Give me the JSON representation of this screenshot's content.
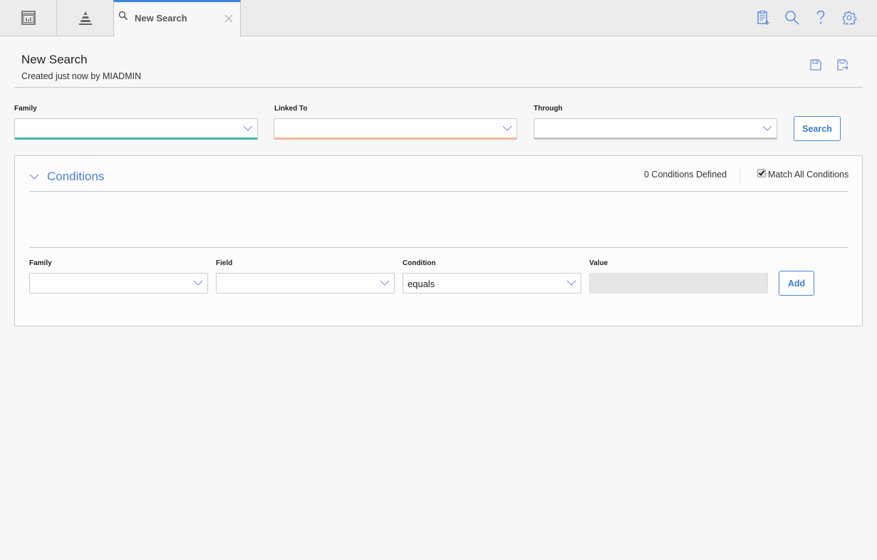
{
  "topbar": {
    "nav_buttons": [
      {
        "name": "dashboard",
        "icon": "dashboard-icon"
      },
      {
        "name": "hierarchy",
        "icon": "pyramid-icon"
      }
    ],
    "active_tab": {
      "label": "New Search",
      "icon": "search-icon",
      "close_icon": "close-icon"
    },
    "right_icons": [
      "new-document-icon",
      "search-icon",
      "help-icon",
      "gear-icon"
    ],
    "accent_color": "#3d85e0"
  },
  "header": {
    "title": "New Search",
    "subtitle": "Created just now by MIADMIN",
    "actions": [
      "save-icon",
      "save-as-icon"
    ]
  },
  "search_fields": {
    "family": {
      "label": "Family",
      "value": "",
      "accent": "#47b0a9"
    },
    "linked_to": {
      "label": "Linked To",
      "value": "",
      "accent": "#f2b995"
    },
    "through": {
      "label": "Through",
      "value": "",
      "accent": "#c1c4c5"
    },
    "search_button": "Search"
  },
  "conditions": {
    "title": "Conditions",
    "count_text": "0 Conditions Defined",
    "match_all_label": "Match All Conditions",
    "match_all_checked": true,
    "row": {
      "family": {
        "label": "Family",
        "value": ""
      },
      "field": {
        "label": "Field",
        "value": ""
      },
      "condition": {
        "label": "Condition",
        "value": "equals"
      },
      "value": {
        "label": "Value",
        "value": ""
      },
      "add_button": "Add"
    }
  }
}
